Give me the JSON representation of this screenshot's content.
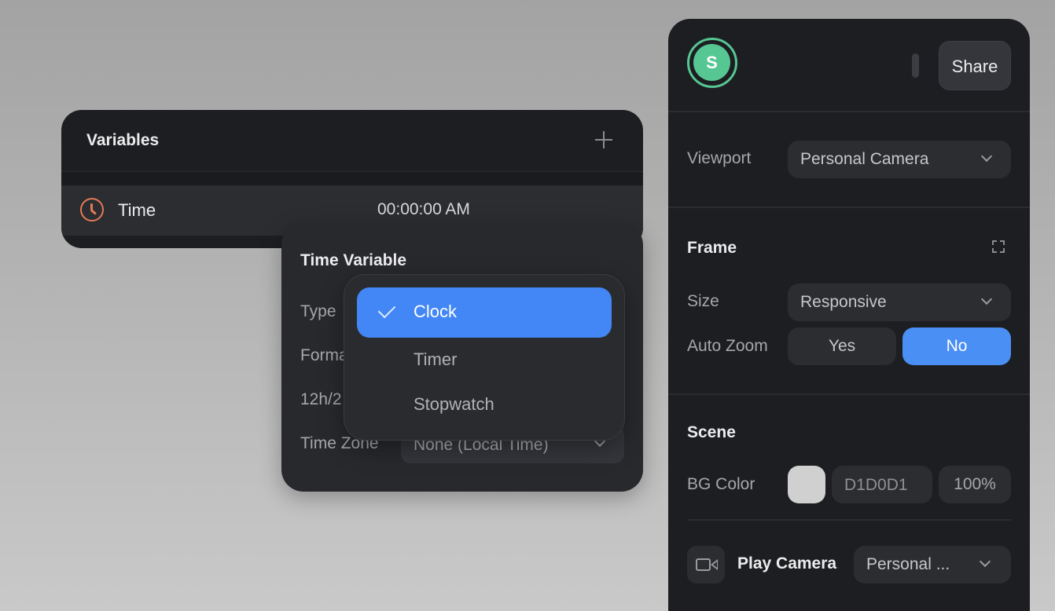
{
  "variables_panel": {
    "title": "Variables",
    "add_icon": "plus-icon",
    "rows": [
      {
        "icon": "clock-icon",
        "name": "Time",
        "value": "00:00:00 AM"
      }
    ]
  },
  "time_variable_popover": {
    "title": "Time Variable",
    "labels": {
      "type": "Type",
      "format": "Forma",
      "hour_mode": "12h/2",
      "time_zone": "Time Zone"
    },
    "time_zone_value": "None (Local Time)"
  },
  "type_menu": {
    "items": [
      {
        "label": "Clock",
        "selected": true
      },
      {
        "label": "Timer",
        "selected": false
      },
      {
        "label": "Stopwatch",
        "selected": false
      }
    ]
  },
  "inspector": {
    "avatar_initial": "S",
    "share_label": "Share",
    "viewport": {
      "label": "Viewport",
      "value": "Personal Camera"
    },
    "frame": {
      "title": "Frame",
      "size_label": "Size",
      "size_value": "Responsive",
      "auto_zoom_label": "Auto Zoom",
      "auto_zoom_yes": "Yes",
      "auto_zoom_no": "No",
      "auto_zoom_selected": "No"
    },
    "scene": {
      "title": "Scene",
      "bg_color_label": "BG Color",
      "bg_color_hex": "D1D0D1",
      "bg_opacity": "100%",
      "swatch_color": "#d1d0d1"
    },
    "play_camera": {
      "label": "Play Camera",
      "value": "Personal ..."
    }
  },
  "colors": {
    "accent_blue": "#4287f5",
    "avatar_green": "#56c693",
    "clock_orange": "#e27a55",
    "panel_bg": "#1d1e21"
  }
}
